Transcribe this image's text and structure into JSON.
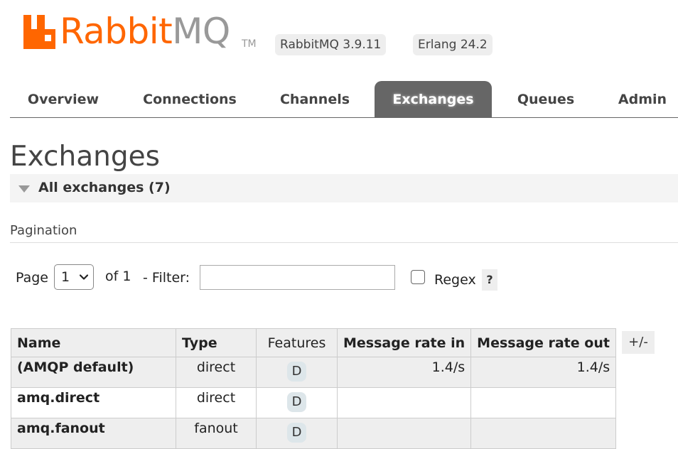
{
  "header": {
    "logo_rabbit": "Rabbit",
    "logo_mq": "MQ",
    "logo_tm": "TM",
    "rabbitmq_version": "RabbitMQ 3.9.11",
    "erlang_version": "Erlang 24.2",
    "brand_color": "#FF6600"
  },
  "tabs": [
    {
      "label": "Overview",
      "active": false
    },
    {
      "label": "Connections",
      "active": false
    },
    {
      "label": "Channels",
      "active": false
    },
    {
      "label": "Exchanges",
      "active": true
    },
    {
      "label": "Queues",
      "active": false
    },
    {
      "label": "Admin",
      "active": false
    }
  ],
  "page": {
    "title": "Exchanges",
    "section_title": "All exchanges (7)"
  },
  "pagination": {
    "label": "Pagination",
    "page_label": "Page",
    "page_value": "1",
    "of_label": "of 1",
    "filter_label": "- Filter:",
    "filter_value": "",
    "regex_label": "Regex",
    "regex_checked": false,
    "help_label": "?"
  },
  "table": {
    "columns": [
      "Name",
      "Type",
      "Features",
      "Message rate in",
      "Message rate out"
    ],
    "toggle_label": "+/-",
    "rows": [
      {
        "name": "(AMQP default)",
        "type": "direct",
        "features": "D",
        "rate_in": "1.4/s",
        "rate_out": "1.4/s"
      },
      {
        "name": "amq.direct",
        "type": "direct",
        "features": "D",
        "rate_in": "",
        "rate_out": ""
      },
      {
        "name": "amq.fanout",
        "type": "fanout",
        "features": "D",
        "rate_in": "",
        "rate_out": ""
      }
    ]
  }
}
